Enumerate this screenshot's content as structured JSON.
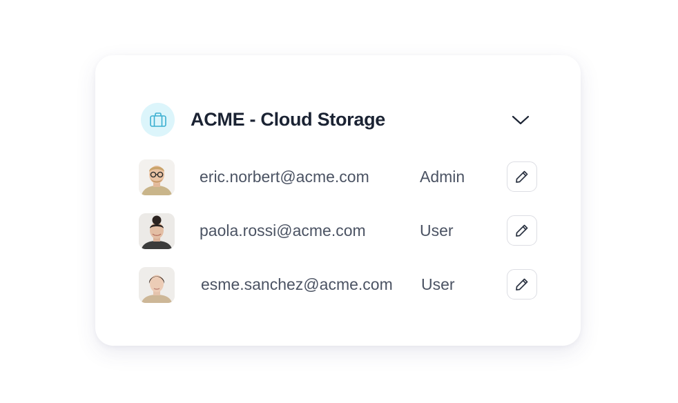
{
  "org": {
    "title": "ACME - Cloud Storage",
    "icon": "briefcase-icon",
    "icon_bg": "#dcf5fb",
    "icon_color": "#3aaed0"
  },
  "users": [
    {
      "email": "eric.norbert@acme.com",
      "role": "Admin"
    },
    {
      "email": "paola.rossi@acme.com",
      "role": "User"
    },
    {
      "email": "esme.sanchez@acme.com",
      "role": "User"
    }
  ],
  "colors": {
    "title": "#1b2333",
    "text": "#4b5363",
    "border": "#dcdde3"
  }
}
